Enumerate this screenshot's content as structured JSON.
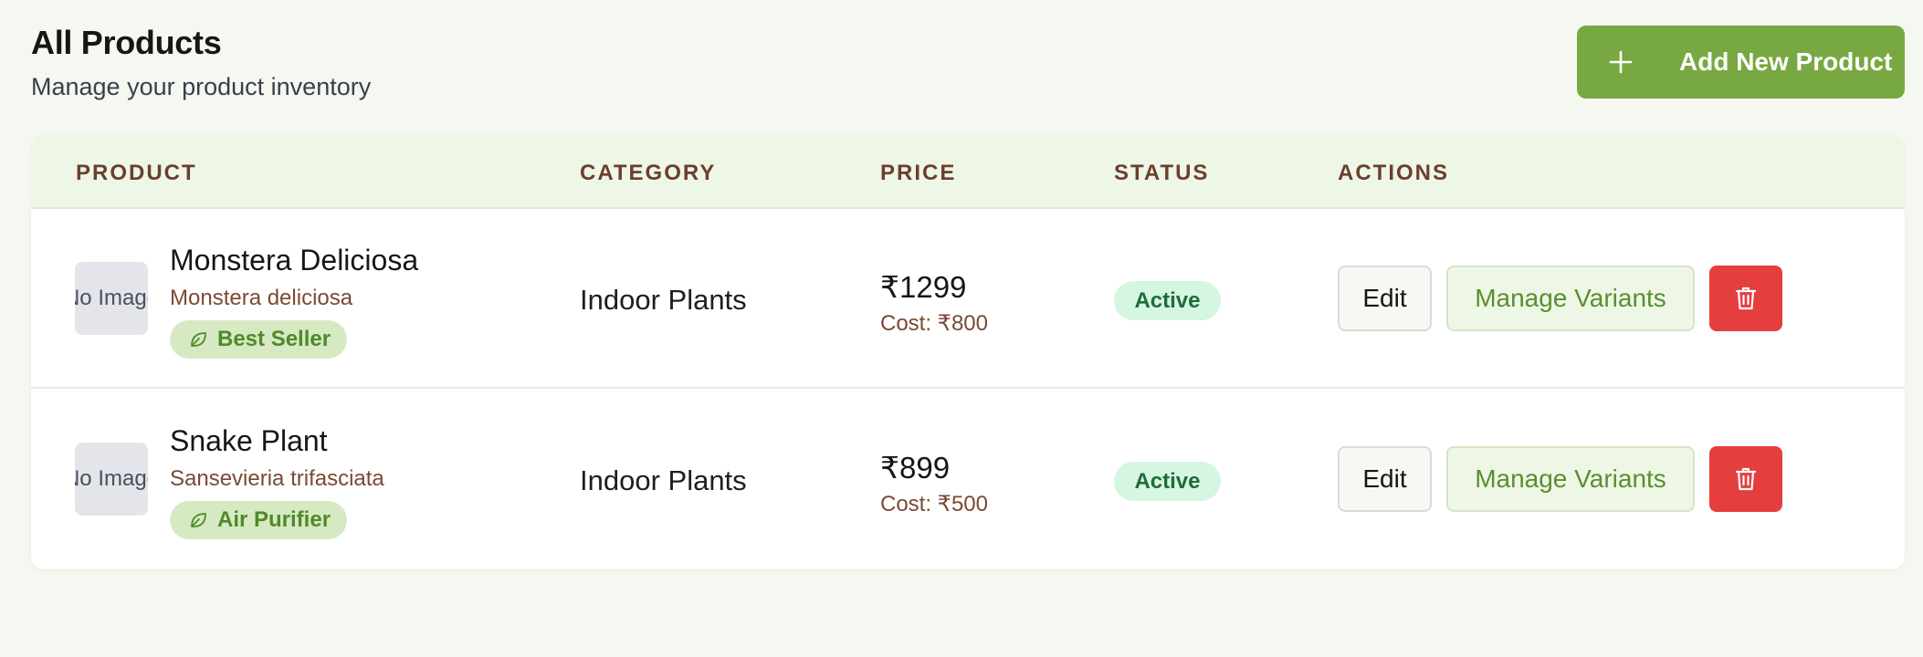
{
  "header": {
    "title": "All Products",
    "subtitle": "Manage your product inventory",
    "add_button_label": "Add New Product"
  },
  "table": {
    "columns": [
      "PRODUCT",
      "CATEGORY",
      "PRICE",
      "STATUS",
      "ACTIONS"
    ],
    "rows": [
      {
        "thumb_text": "No Image",
        "name": "Monstera Deliciosa",
        "scientific_name": "Monstera deliciosa",
        "tag": "Best Seller",
        "category": "Indoor Plants",
        "price": "₹1299",
        "cost": "Cost: ₹800",
        "status": "Active",
        "edit_label": "Edit",
        "variants_label": "Manage Variants"
      },
      {
        "thumb_text": "No Image",
        "name": "Snake Plant",
        "scientific_name": "Sansevieria trifasciata",
        "tag": "Air Purifier",
        "category": "Indoor Plants",
        "price": "₹899",
        "cost": "Cost: ₹500",
        "status": "Active",
        "edit_label": "Edit",
        "variants_label": "Manage Variants"
      }
    ]
  },
  "icons": {
    "add": "plus-icon",
    "tag": "leaf-icon",
    "delete": "trash-icon"
  },
  "colors": {
    "primary": "#78a842",
    "danger": "#e53e3e",
    "status_active_bg": "#d5f6e1",
    "header_bg": "#eef6e6"
  }
}
